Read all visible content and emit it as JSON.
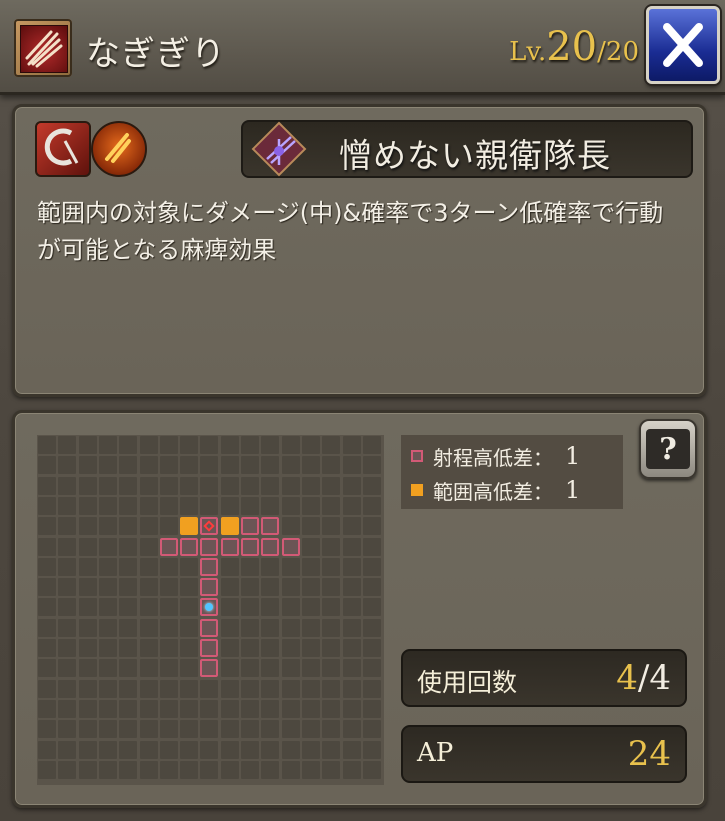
{
  "header": {
    "skill_name": "なぎぎり",
    "level_label": "Lv.",
    "level_current": "20",
    "level_separator": "/",
    "level_max": "20",
    "skill_icon": "slash-claw-icon",
    "close_icon": "close-x-icon"
  },
  "skill": {
    "attribute_icons": [
      "scythe-icon",
      "fire-slash-icon"
    ],
    "title_name": "憎めない親衛隊長",
    "title_icon": "ornate-sword-emblem-icon",
    "description": "範囲内の対象にダメージ(中)&確率で3ターン低確率で行動が可能となる麻痺効果"
  },
  "range": {
    "legend": [
      {
        "label": "射程高低差：",
        "value": "1",
        "swatch_color": "#d25a76"
      },
      {
        "label": "範囲高低差：",
        "value": "1",
        "swatch_color": "#f1a020"
      }
    ],
    "help_icon": "help-question-icon",
    "grid": {
      "cols": 17,
      "rows": 17,
      "range_cells": [
        [
          5,
          6
        ],
        [
          5,
          7
        ],
        [
          5,
          8
        ],
        [
          5,
          9
        ],
        [
          5,
          10
        ],
        [
          5,
          11
        ],
        [
          5,
          12
        ],
        [
          6,
          8
        ],
        [
          7,
          8
        ],
        [
          8,
          8
        ],
        [
          9,
          8
        ],
        [
          10,
          8
        ],
        [
          11,
          8
        ],
        [
          4,
          9
        ],
        [
          4,
          10
        ],
        [
          4,
          11
        ]
      ],
      "area_cells": [
        [
          4,
          7
        ],
        [
          4,
          9
        ]
      ],
      "target_cell": [
        4,
        8
      ],
      "center_cell": [
        8,
        8
      ]
    }
  },
  "stats": {
    "uses_label": "使用回数",
    "uses_current": "4",
    "uses_separator": "/",
    "uses_max": "4",
    "ap_label": "AP",
    "ap_value": "24"
  },
  "colors": {
    "accent_gold": "#e8c14d",
    "range_pink": "#d25a76",
    "area_orange": "#f1a020",
    "center_blue": "#51c5ff",
    "close_blue": "#1a2c93"
  }
}
